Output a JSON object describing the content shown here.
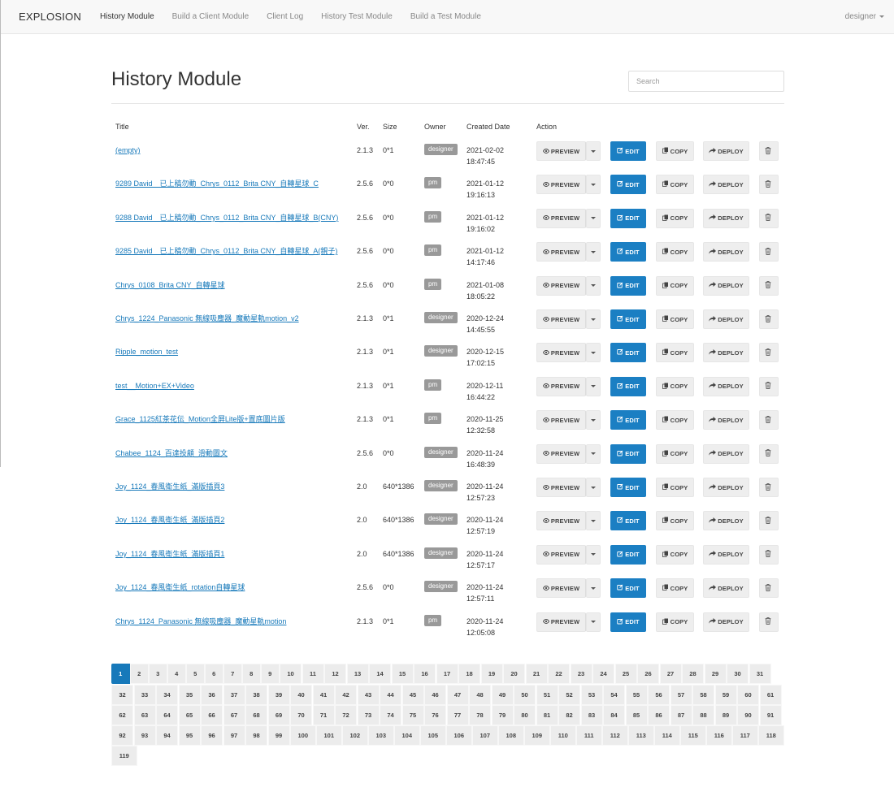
{
  "navbar": {
    "brand": "EXPLOSION",
    "items": [
      "History Module",
      "Build a Client Module",
      "Client Log",
      "History Test Module",
      "Build a Test Module"
    ],
    "active_index": 0,
    "user": "designer"
  },
  "page": {
    "title": "History Module",
    "search_placeholder": "Search"
  },
  "table": {
    "headers": [
      "Title",
      "Ver.",
      "Size",
      "Owner",
      "Created Date",
      "Action"
    ],
    "actions": {
      "preview": "PREVIEW",
      "edit": "EDIT",
      "copy": "COPY",
      "deploy": "DEPLOY"
    },
    "rows": [
      {
        "title": "(empty)",
        "ver": "2.1.3",
        "size": "0*1",
        "owner": "designer",
        "date": "2021-02-02",
        "time": "18:47:45"
      },
      {
        "title": "9289 David　已上稿勿動_Chrys_0112_Brita CNY_自轉星球_C",
        "ver": "2.5.6",
        "size": "0*0",
        "owner": "pm",
        "date": "2021-01-12",
        "time": "19:16:13"
      },
      {
        "title": "9288 David　已上稿勿動_Chrys_0112_Brita CNY_自轉星球_B(CNY)",
        "ver": "2.5.6",
        "size": "0*0",
        "owner": "pm",
        "date": "2021-01-12",
        "time": "19:16:02"
      },
      {
        "title": "9285 David　已上稿勿動_Chrys_0112_Brita CNY_自轉星球_A(親子)",
        "ver": "2.5.6",
        "size": "0*0",
        "owner": "pm",
        "date": "2021-01-12",
        "time": "14:17:46"
      },
      {
        "title": "Chrys_0108_Brita CNY_自轉星球",
        "ver": "2.5.6",
        "size": "0*0",
        "owner": "pm",
        "date": "2021-01-08",
        "time": "18:05:22"
      },
      {
        "title": "Chrys_1224_Panasonic 無線吸塵器_魔動星軌motion_v2",
        "ver": "2.1.3",
        "size": "0*1",
        "owner": "designer",
        "date": "2020-12-24",
        "time": "14:45:55"
      },
      {
        "title": "Ripple_motion_test",
        "ver": "2.1.3",
        "size": "0*1",
        "owner": "designer",
        "date": "2020-12-15",
        "time": "17:02:15"
      },
      {
        "title": "test__Motion+EX+Video",
        "ver": "2.1.3",
        "size": "0*1",
        "owner": "pm",
        "date": "2020-12-11",
        "time": "16:44:22"
      },
      {
        "title": "Grace_1125紅茶花伝_Motion全屏Lite版+置底圖片版",
        "ver": "2.1.3",
        "size": "0*1",
        "owner": "pm",
        "date": "2020-11-25",
        "time": "12:32:58"
      },
      {
        "title": "Chabee_1124_百達投顧_滑動圖文",
        "ver": "2.5.6",
        "size": "0*0",
        "owner": "designer",
        "date": "2020-11-24",
        "time": "16:48:39"
      },
      {
        "title": "Joy_1124_春風衛生紙_滿版插頁3",
        "ver": "2.0",
        "size": "640*1386",
        "owner": "designer",
        "date": "2020-11-24",
        "time": "12:57:23"
      },
      {
        "title": "Joy_1124_春風衛生紙_滿版插頁2",
        "ver": "2.0",
        "size": "640*1386",
        "owner": "designer",
        "date": "2020-11-24",
        "time": "12:57:19"
      },
      {
        "title": "Joy_1124_春風衛生紙_滿版插頁1",
        "ver": "2.0",
        "size": "640*1386",
        "owner": "designer",
        "date": "2020-11-24",
        "time": "12:57:17"
      },
      {
        "title": "Joy_1124_春風衛生紙_rotation自轉星球",
        "ver": "2.5.6",
        "size": "0*0",
        "owner": "designer",
        "date": "2020-11-24",
        "time": "12:57:11"
      },
      {
        "title": "Chrys_1124_Panasonic 無線吸塵器_魔動星軌motion",
        "ver": "2.1.3",
        "size": "0*1",
        "owner": "pm",
        "date": "2020-11-24",
        "time": "12:05:08"
      }
    ]
  },
  "pagination": {
    "current": 1,
    "rows": [
      [
        1,
        2,
        3,
        4,
        5,
        6,
        7,
        8,
        9,
        10,
        11,
        12,
        13,
        14,
        15,
        16,
        17,
        18,
        19,
        20,
        21,
        22,
        23,
        24,
        25,
        26,
        27,
        28,
        29,
        30,
        31
      ],
      [
        32,
        33,
        34,
        35,
        36,
        37,
        38,
        39,
        40,
        41,
        42,
        43,
        44,
        45,
        46,
        47,
        48,
        49,
        50,
        51,
        52,
        53,
        54,
        55,
        56,
        57,
        58,
        59,
        60,
        61
      ],
      [
        62,
        63,
        64,
        65,
        66,
        67,
        68,
        69,
        70,
        71,
        72,
        73,
        74,
        75,
        76,
        77,
        78,
        79,
        80,
        81,
        82,
        83,
        84,
        85,
        86,
        87,
        88,
        89,
        90,
        91
      ],
      [
        92,
        93,
        94,
        95,
        96,
        97,
        98,
        99,
        100,
        101,
        102,
        103,
        104,
        105,
        106,
        107,
        108,
        109,
        110,
        111,
        112,
        113,
        114,
        115,
        116,
        117,
        118
      ],
      [
        119
      ]
    ]
  }
}
